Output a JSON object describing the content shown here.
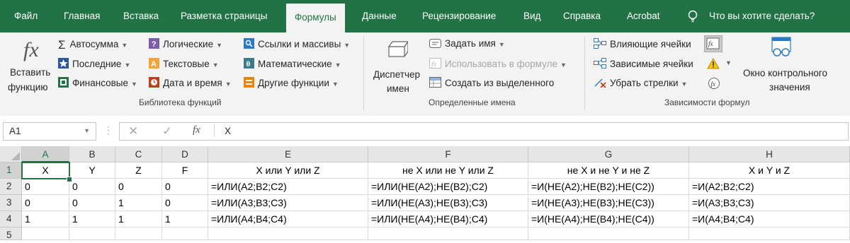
{
  "tabs": [
    "Файл",
    "Главная",
    "Вставка",
    "Разметка страницы",
    "Формулы",
    "Данные",
    "Рецензирование",
    "Вид",
    "Справка",
    "Acrobat"
  ],
  "active_tab": "Формулы",
  "tell_me": "Что вы хотите сделать?",
  "ribbon": {
    "insert_function": {
      "line1": "Вставить",
      "line2": "функцию",
      "icon": "fx-icon"
    },
    "library": {
      "autosum": "Автосумма",
      "recent": "Последние",
      "financial": "Финансовые",
      "logical": "Логические",
      "text": "Текстовые",
      "datetime": "Дата и время",
      "lookup": "Ссылки и массивы",
      "math": "Математические",
      "more": "Другие функции",
      "label": "Библиотека функций"
    },
    "names": {
      "manager_line1": "Диспетчер",
      "manager_line2": "имен",
      "define": "Задать имя",
      "use": "Использовать в формуле",
      "create": "Создать из выделенного",
      "label": "Определенные имена"
    },
    "audit": {
      "precedents": "Влияющие ячейки",
      "dependents": "Зависимые ячейки",
      "remove": "Убрать стрелки",
      "label": "Зависимости формул"
    },
    "watch": {
      "line1": "Окно контрольного",
      "line2": "значения"
    }
  },
  "formula_bar": {
    "name_box": "A1",
    "fx": "fx",
    "value": "X"
  },
  "columns": [
    "A",
    "B",
    "C",
    "D",
    "E",
    "F",
    "G",
    "H"
  ],
  "rows": [
    [
      "X",
      "Y",
      "Z",
      "F",
      "X или Y или Z",
      "не X или не Y или Z",
      "не X и не Y и не Z",
      "X и Y и Z"
    ],
    [
      "0",
      "0",
      "0",
      "0",
      "=ИЛИ(A2;B2;C2)",
      "=ИЛИ(НЕ(A2);НЕ(B2);C2)",
      "=И(НЕ(A2);НЕ(B2);НЕ(C2))",
      "=И(A2;B2;C2)"
    ],
    [
      "0",
      "0",
      "1",
      "0",
      "=ИЛИ(A3;B3;C3)",
      "=ИЛИ(НЕ(A3);НЕ(B3);C3)",
      "=И(НЕ(A3);НЕ(B3);НЕ(C3))",
      "=И(A3;B3;C3)"
    ],
    [
      "1",
      "1",
      "1",
      "1",
      "=ИЛИ(A4;B4;C4)",
      "=ИЛИ(НЕ(A4);НЕ(B4);C4)",
      "=И(НЕ(A4);НЕ(B4);НЕ(C4))",
      "=И(A4;B4;C4)"
    ]
  ],
  "row_numbers": [
    "1",
    "2",
    "3",
    "4",
    "5"
  ],
  "colors": {
    "accent": "#217346"
  }
}
